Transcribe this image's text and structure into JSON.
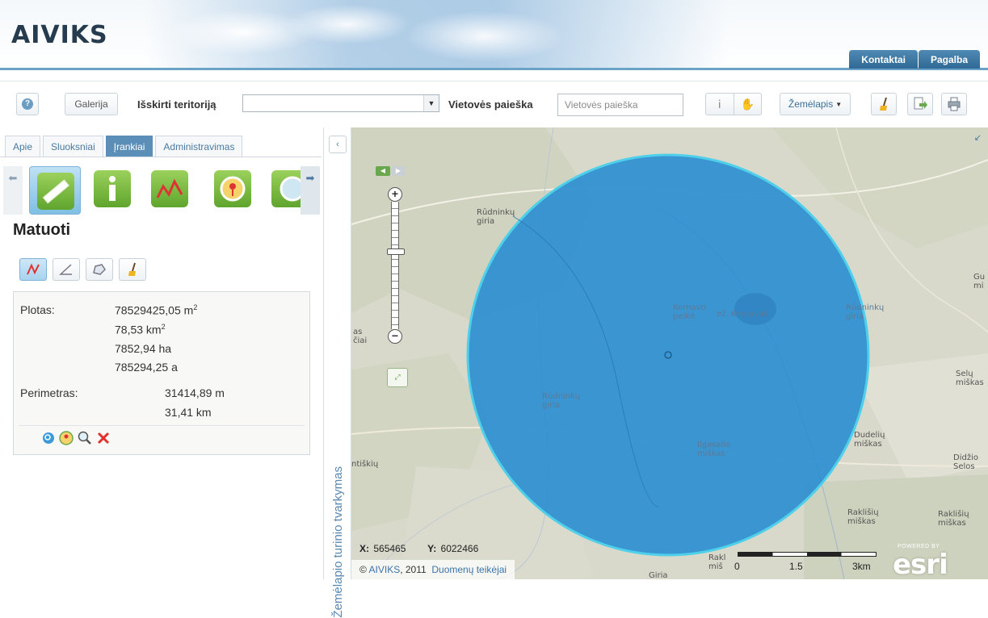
{
  "header": {
    "logo": "AIVIKS",
    "links": [
      "Kontaktai",
      "Pagalba"
    ]
  },
  "toolbar": {
    "help_icon": "question-mark-icon",
    "gallery_label": "Galerija",
    "territory_label": "Išskirti teritoriją",
    "territory_value": "",
    "place_label": "Vietovės paieška",
    "place_placeholder": "Vietovės paieška",
    "basemap_label": "Žemėlapis",
    "mode_icons": [
      "info-cursor-icon",
      "pan-hand-icon"
    ],
    "right_icons": [
      "broom-clear-icon",
      "export-icon",
      "print-icon"
    ]
  },
  "left_panel": {
    "tabs": [
      {
        "label": "Apie",
        "active": false
      },
      {
        "label": "Sluoksniai",
        "active": false
      },
      {
        "label": "Įrankiai",
        "active": true
      },
      {
        "label": "Administravimas",
        "active": false
      }
    ],
    "tools": [
      "ruler-icon",
      "info-icon",
      "profile-icon",
      "locate-icon",
      "globe-icon"
    ],
    "measure_title": "Matuoti",
    "measure_modes": [
      "polyline-icon",
      "angle-icon",
      "polygon-icon",
      "clear-broom-icon"
    ],
    "results": {
      "area_label": "Plotas:",
      "area_m2": "78529425,05 m",
      "area_km2": "78,53 km",
      "area_ha": "7852,94 ha",
      "area_a": "785294,25 a",
      "sq_sup": "2",
      "perimeter_label": "Perimetras:",
      "perimeter_m": "31414,89 m",
      "perimeter_km": "31,41 km"
    },
    "result_actions": [
      "zoom-to-icon",
      "locate-icon",
      "magnify-icon",
      "delete-icon"
    ]
  },
  "collapse": {
    "toc_label": "Žemėlapio turinio tvarkymas"
  },
  "map": {
    "labels": [
      "Rūdninkų\ngiria",
      "Kernavo\npelkė",
      "ež. Kernavas",
      "Rūdninkų\ngiria",
      "Rūdninkų\ngiria",
      "Ilgasalio\nmiškas",
      "Dudelių\nmiškas",
      "Raklišių\nmiškas",
      "Raklišių\nmiškas",
      "ntiškių",
      "Selų\nmiškas",
      "Gu\nmi",
      "Didžio\nSelos",
      "as\nčiai",
      "Rakl\nmiš",
      "Giria"
    ],
    "x_label": "X:",
    "x_value": "565465",
    "y_label": "Y:",
    "y_value": "6022466",
    "attribution_prefix": "© ",
    "attribution_link": "AIVIKS",
    "attribution_year": ", 2011",
    "attribution_provider": "Duomenų teikėjai",
    "scale_labels": [
      "0",
      "1.5",
      "3km"
    ],
    "powered_by": "POWERED BY",
    "esri": "esri",
    "circle_fill": "#2d8fd1",
    "circle_stroke": "#4fd0ea"
  }
}
